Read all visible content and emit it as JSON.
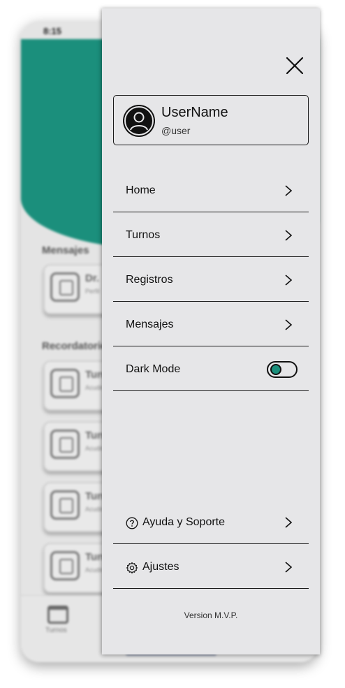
{
  "background_app": {
    "status_time": "8:15",
    "section_messages": "Mensajes",
    "section_reminders": "Recordatorios",
    "message_card": {
      "title": "Dr.",
      "subtitle": "Perfil"
    },
    "reminder_cards": [
      {
        "title": "Turno",
        "subtitle": "Acudir"
      },
      {
        "title": "Turno",
        "subtitle": "Acudir"
      },
      {
        "title": "Turno",
        "subtitle": "Acudir"
      },
      {
        "title": "Turno",
        "subtitle": "Acudir"
      }
    ],
    "bottom_nav_label": "Turnos",
    "accent_color": "#1b8f7c"
  },
  "drawer": {
    "close_icon": "close-icon",
    "user": {
      "name": "UserName",
      "handle": "@user",
      "avatar_icon": "user-avatar-icon"
    },
    "menu_items": [
      {
        "label": "Home"
      },
      {
        "label": "Turnos"
      },
      {
        "label": "Registros"
      },
      {
        "label": "Mensajes"
      }
    ],
    "dark_mode": {
      "label": "Dark Mode",
      "enabled": false
    },
    "footer_items": [
      {
        "label": "Ayuda y Soporte",
        "icon": "help-circle-icon"
      },
      {
        "label": "Ajustes",
        "icon": "gear-icon"
      }
    ],
    "version": "Version M.V.P."
  }
}
